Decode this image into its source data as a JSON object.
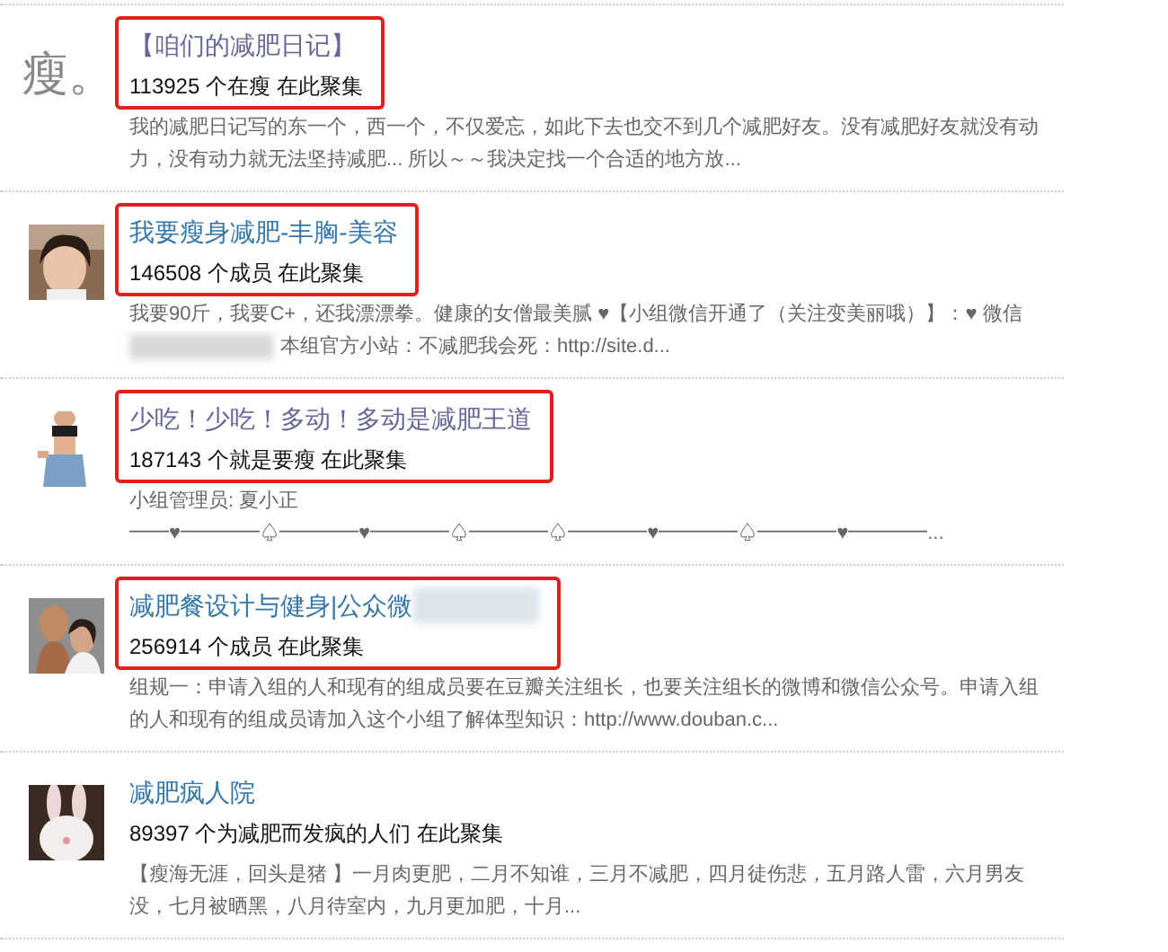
{
  "groups": [
    {
      "avatar": {
        "kind": "text",
        "text": "瘦。"
      },
      "title": "【咱们的减肥日记】",
      "visited": true,
      "title_blurred": false,
      "highlighted": true,
      "members": "113925 个在瘦 在此聚集",
      "description_parts": [
        "我的减肥日记写的东一个，西一个，不仅爱忘，如此下去也交不到几个减肥好友。没有减肥好友就没有动力，没有动力就无法坚持减肥... 所以～～我决定找一个合适的地方放..."
      ]
    },
    {
      "avatar": {
        "kind": "picture"
      },
      "title": "我要瘦身减肥-丰胸-美容",
      "visited": false,
      "title_blurred": false,
      "highlighted": true,
      "members": "146508 个成员 在此聚集",
      "description_parts": [
        "我要90斤，我要C+，还我漂漂拳。健康的女僧最美腻 ♥【小组微信开通了（关注变美丽哦）】：♥ 微信",
        "本组官方小站：不减肥我会死：http://site.d..."
      ]
    },
    {
      "avatar": {
        "kind": "picture"
      },
      "title": "少吃！少吃！多动！多动是减肥王道",
      "visited": true,
      "title_blurred": false,
      "highlighted": true,
      "members": "187143 个就是要瘦 在此聚集",
      "description_parts": [
        "小组管理员: 夏小正 ━━♥━━━━♤━━━━♥━━━━♤━━━━♤━━━━♥━━━━♤━━━━♥━━━━..."
      ]
    },
    {
      "avatar": {
        "kind": "picture"
      },
      "title": "减肥餐设计与健身|公众微",
      "visited": false,
      "title_blurred": true,
      "highlighted": true,
      "members": "256914 个成员 在此聚集",
      "description_parts": [
        "组规一：申请入组的人和现有的组成员要在豆瓣关注组长，也要关注组长的微博和微信公众号。申请入组的人和现有的组成员请加入这个小组了解体型知识：http://www.douban.c..."
      ]
    },
    {
      "avatar": {
        "kind": "picture"
      },
      "title": "减肥疯人院",
      "visited": false,
      "title_blurred": false,
      "highlighted": false,
      "members": "89397 个为减肥而发疯的人们 在此聚集",
      "description_parts": [
        "【瘦海无涯，回头是猪 】一月肉更肥，二月不知谁，三月不减肥，四月徒伤悲，五月路人雷，六月男友没，七月被晒黑，八月待室内，九月更加肥，十月..."
      ]
    }
  ]
}
